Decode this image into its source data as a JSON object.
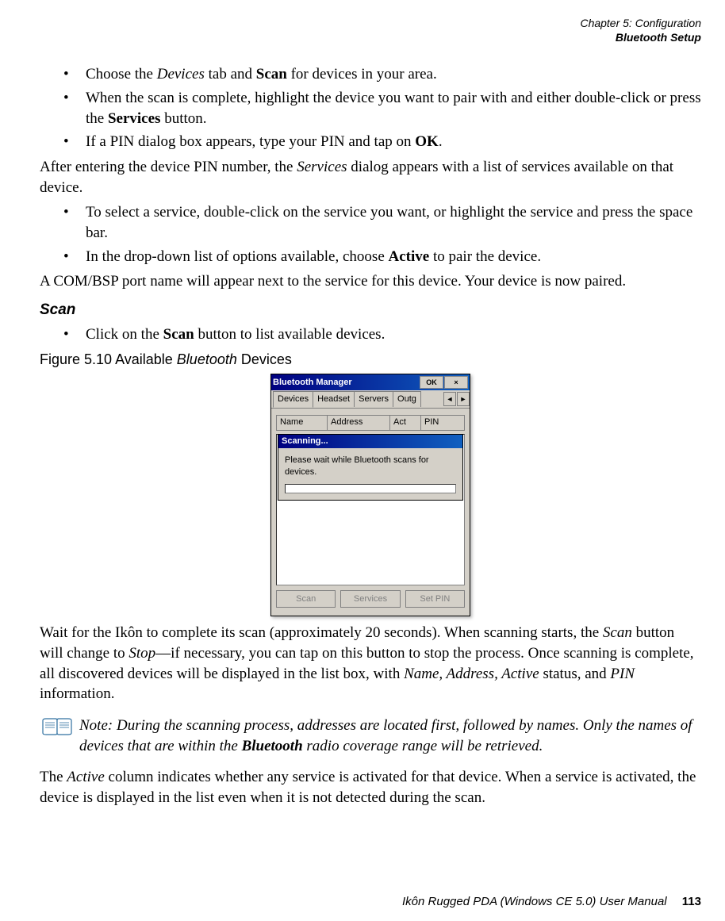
{
  "header": {
    "line1": "Chapter 5: Configuration",
    "line2": "Bluetooth Setup"
  },
  "bullets1": {
    "item1_pre": "Choose the ",
    "item1_em": "Devices",
    "item1_mid": " tab and ",
    "item1_b": "Scan",
    "item1_post": " for devices in your area.",
    "item2_pre": "When the scan is complete, highlight the device you want to pair with and either double-click or press the ",
    "item2_b": "Services",
    "item2_post": " button.",
    "item3_pre": "If a PIN dialog box appears, type your PIN and tap on ",
    "item3_b": "OK",
    "item3_post": "."
  },
  "para1_pre": "After entering the device PIN number, the ",
  "para1_em": "Services",
  "para1_post": " dialog appears with a list of services available on that device.",
  "bullets2": {
    "item1": "To select a service, double-click on the service you want, or highlight the service and press the space bar.",
    "item2_pre": "In the drop-down list of options available, choose ",
    "item2_b": "Active",
    "item2_post": " to pair the device."
  },
  "para2": "A COM/BSP port name will appear next to the service for this device. Your device is now paired.",
  "section_heading": "Scan",
  "bullets3": {
    "item1_pre": "Click on the ",
    "item1_b": "Scan",
    "item1_post": " button to list available devices."
  },
  "figure_caption_pre": "Figure 5.10 Available ",
  "figure_caption_em": "Bluetooth",
  "figure_caption_post": " Devices",
  "screenshot": {
    "title": "Bluetooth Manager",
    "ok": "OK",
    "close": "×",
    "tabs": [
      "Devices",
      "Headset",
      "Servers",
      "Outg"
    ],
    "arrows": {
      "left": "◄",
      "right": "►"
    },
    "columns": {
      "name": "Name",
      "address": "Address",
      "act": "Act",
      "pin": "PIN"
    },
    "dialog_title": "Scanning...",
    "dialog_body": "Please wait while Bluetooth scans for devices.",
    "buttons": {
      "scan": "Scan",
      "services": "Services",
      "setpin": "Set PIN"
    }
  },
  "para3_pre": "Wait for the Ikôn to complete its scan (approximately 20 seconds). When scanning starts, the ",
  "para3_em1": "Scan",
  "para3_mid1": " button will change to ",
  "para3_em2": "Stop",
  "para3_mid2": "—if necessary, you can tap on this button to stop the process. Once scanning is complete, all discovered devices will be displayed in the list box, with ",
  "para3_em3": "Name, Address, Active",
  "para3_mid3": " status, and ",
  "para3_em4": "PIN",
  "para3_post": " information.",
  "note": {
    "label": "Note:",
    "text_pre": " During the scanning process, addresses are located first, followed by names. Only the names of devices that are within the ",
    "text_b": "Bluetooth",
    "text_post": " radio coverage range will be retrieved."
  },
  "para4_pre": "The ",
  "para4_em": "Active",
  "para4_post": " column indicates whether any service is activated for that device. When a service is activated, the device is displayed in the list even when it is not detected during the scan.",
  "footer": {
    "text": "Ikôn Rugged PDA (Windows CE 5.0) User Manual",
    "page": "113"
  }
}
